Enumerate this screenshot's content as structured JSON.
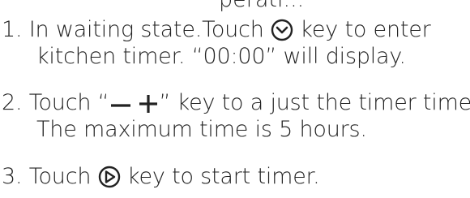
{
  "cutoff_text": "perati...",
  "steps": [
    {
      "number": "1.",
      "text_a": "In waiting state.Touch",
      "icon": "chevron-down-circle-icon",
      "text_b": "key to enter",
      "line2": "kitchen timer. “00:00” will display."
    },
    {
      "number": "2.",
      "text_a": "Touch “",
      "icon_minus": "minus-icon",
      "icon_plus": "plus-icon",
      "text_b": "” key to a just the timer time.",
      "line2": "The maximum time is 5 hours."
    },
    {
      "number": "3.",
      "text_a": "Touch",
      "icon": "play-circle-icon",
      "text_b": "key to start timer."
    }
  ]
}
